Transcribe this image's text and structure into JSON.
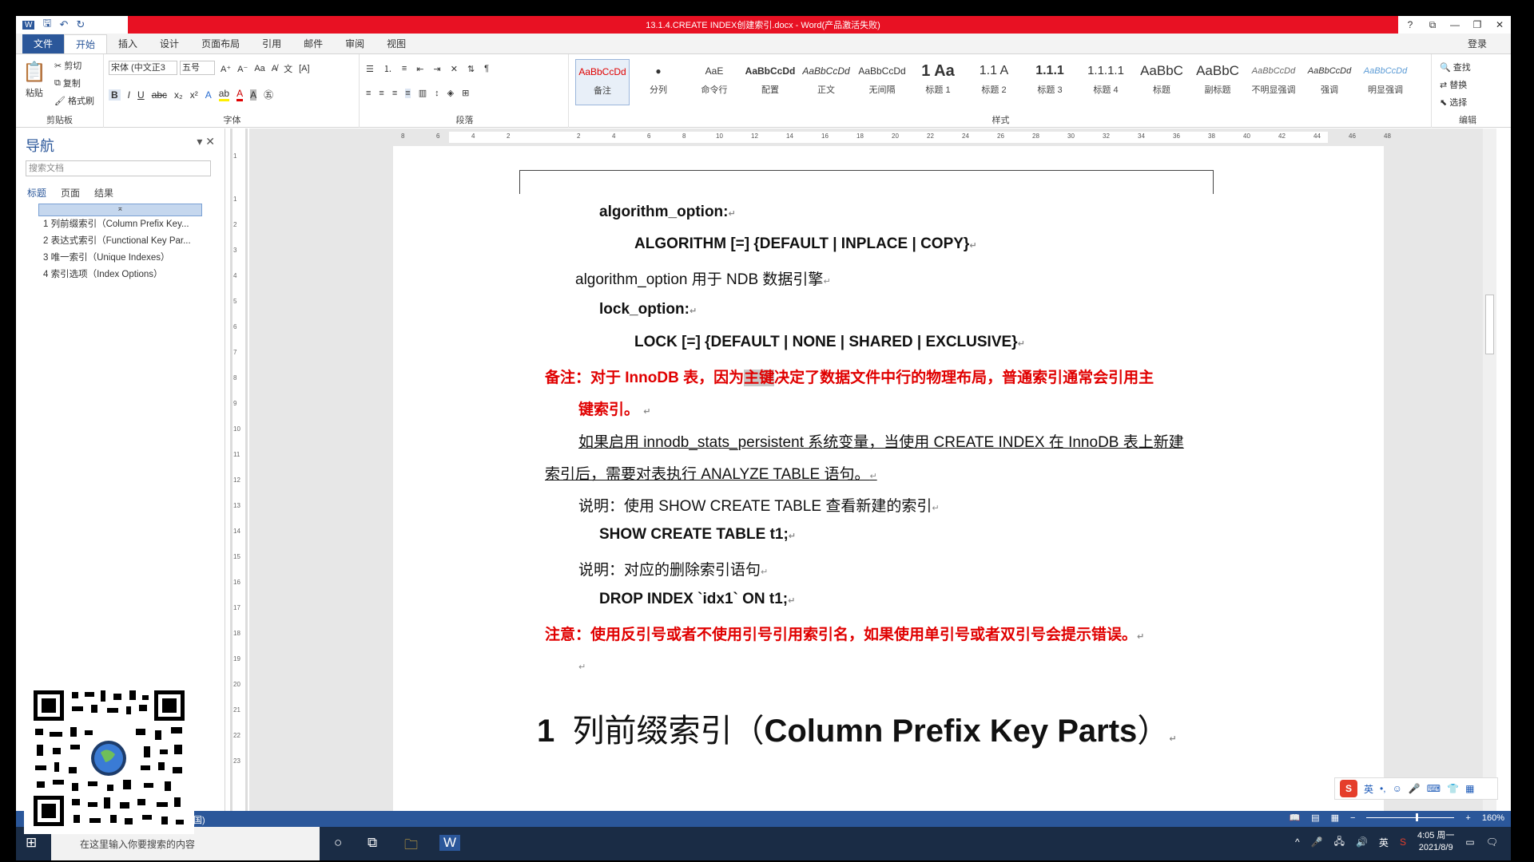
{
  "window": {
    "title": "13.1.4.CREATE INDEX创建索引.docx - Word(产品激活失败)",
    "controls": [
      "?",
      "⧉",
      "—",
      "❐",
      "✕"
    ]
  },
  "tabs": [
    "文件",
    "开始",
    "插入",
    "设计",
    "页面布局",
    "引用",
    "邮件",
    "审阅",
    "视图"
  ],
  "login": "登录",
  "ribbon": {
    "clipboard": {
      "paste": "粘贴",
      "cut": "剪切",
      "copy": "复制",
      "format_painter": "格式刷",
      "label": "剪贴板"
    },
    "font": {
      "name": "宋体 (中文正3",
      "size": "五号",
      "label": "字体"
    },
    "paragraph": {
      "label": "段落"
    },
    "styles": {
      "label": "样式",
      "items": [
        {
          "preview": "AaBbCcDd",
          "name": "备注"
        },
        {
          "preview": "●",
          "name": "分列"
        },
        {
          "preview": "AaE",
          "name": "命令行"
        },
        {
          "preview": "AaBbCcDd",
          "name": "配置"
        },
        {
          "preview": "AaBbCcDd",
          "name": "正文"
        },
        {
          "preview": "AaBbCcDd",
          "name": "无间隔"
        },
        {
          "preview": "1 Aa",
          "name": "标题 1"
        },
        {
          "preview": "1.1 A",
          "name": "标题 2"
        },
        {
          "preview": "1.1.1",
          "name": "标题 3"
        },
        {
          "preview": "1.1.1.1",
          "name": "标题 4"
        },
        {
          "preview": "AaBbC",
          "name": "标题"
        },
        {
          "preview": "AaBbC",
          "name": "副标题"
        },
        {
          "preview": "AaBbCcDd",
          "name": "不明显强调"
        },
        {
          "preview": "AaBbCcDd",
          "name": "强调"
        },
        {
          "preview": "AaBbCcDd",
          "name": "明显强调"
        }
      ]
    },
    "editing": {
      "find": "查找",
      "replace": "替换",
      "select": "选择",
      "label": "编辑"
    }
  },
  "nav": {
    "title": "导航",
    "search_placeholder": "搜索文档",
    "tabs": [
      "标题",
      "页面",
      "结果"
    ],
    "items": [
      "1 列前缀索引（Column Prefix Key...",
      "2 表达式索引（Functional Key Par...",
      "3 唯一索引（Unique Indexes）",
      "4 索引选项（Index Options）"
    ]
  },
  "ruler_numbers": [
    "8",
    "6",
    "4",
    "2",
    "2",
    "4",
    "6",
    "8",
    "10",
    "12",
    "14",
    "16",
    "18",
    "20",
    "22",
    "24",
    "26",
    "28",
    "30",
    "32",
    "34",
    "36",
    "38",
    "40",
    "42",
    "44",
    "46",
    "48"
  ],
  "vruler_numbers": [
    "1",
    "1",
    "2",
    "3",
    "4",
    "5",
    "6",
    "7",
    "8",
    "9",
    "10",
    "11",
    "12",
    "13",
    "14",
    "15",
    "16",
    "17",
    "18",
    "19",
    "20",
    "21",
    "22",
    "23"
  ],
  "doc": {
    "algorithm_label": "algorithm_option:",
    "algorithm_syntax": "ALGORITHM [=] {DEFAULT | INPLACE | COPY}",
    "algorithm_desc": "algorithm_option 用于 NDB 数据引擎",
    "lock_label": "lock_option:",
    "lock_syntax": "LOCK [=] {DEFAULT | NONE | SHARED | EXCLUSIVE}",
    "note1_a": "备注：对于 InnoDB 表，因为",
    "note1_hl": "主键",
    "note1_b": "决定了数据文件中行的物理布局，普通索引通常会引用主",
    "note1_c": "键索引。",
    "para1_a": "如果启用 innodb_stats_persistent 系统变量，当使用 CREATE INDEX 在 InnoDB 表上新建",
    "para1_b": "索引后，需要对表执行 ANALYZE TABLE 语句。",
    "explain1": "说明：使用 SHOW CREATE TABLE 查看新建的索引",
    "code1": "SHOW CREATE TABLE t1;",
    "explain2": "说明：对应的删除索引语句",
    "code2": "DROP INDEX `idx1` ON t1;",
    "note2": "注意：使用反引号或者不使用引号引用索引名，如果使用单引号或者双引号会提示错误。",
    "heading_num": "1",
    "heading_cn": "列前缀索引（",
    "heading_en": "Column Prefix Key Parts",
    "heading_close": "）"
  },
  "statusbar": {
    "left": "国)",
    "zoom": "160%"
  },
  "taskbar": {
    "search_placeholder": "在这里输入你要搜索的内容",
    "ime": "英",
    "time": "4:05 周一",
    "date": "2021/8/9"
  },
  "ime_bar": {
    "logo": "S",
    "lang": "英"
  },
  "colors": {
    "accent": "#2b579a",
    "title_red": "#e81123",
    "note_red": "#e00000"
  }
}
